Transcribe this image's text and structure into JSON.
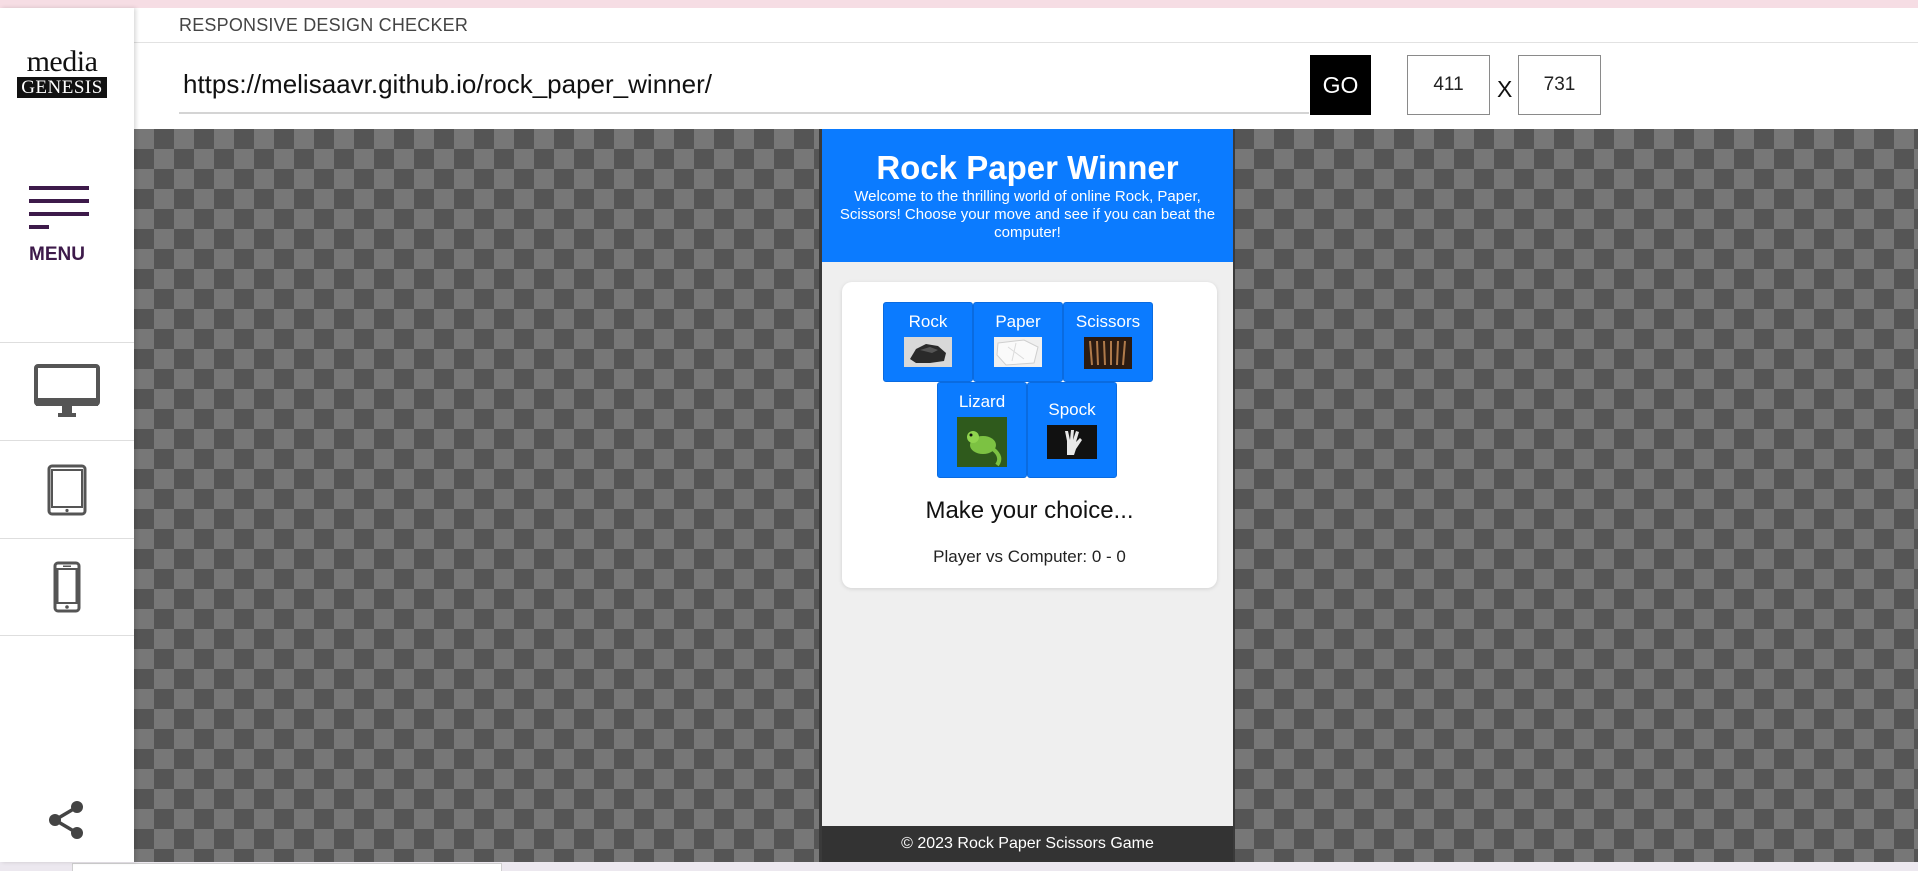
{
  "app": {
    "title": "RESPONSIVE DESIGN CHECKER",
    "logo_top": "media",
    "logo_bottom": "GENESIS",
    "menu_label": "MENU"
  },
  "sidebar": {
    "devices": [
      {
        "name": "desktop",
        "icon": "desktop-icon"
      },
      {
        "name": "tablet",
        "icon": "tablet-icon"
      },
      {
        "name": "phone",
        "icon": "phone-icon"
      }
    ],
    "share_icon": "share-icon"
  },
  "toolbar": {
    "url": "https://melisaavr.github.io/rock_paper_winner/",
    "go_label": "GO",
    "width": "411",
    "x_label": "X",
    "height": "731"
  },
  "preview": {
    "title": "Rock Paper Winner",
    "intro": "Welcome to the thrilling world of online Rock, Paper, Scissors! Choose your move and see if you can beat the computer!",
    "choices": [
      {
        "label": "Rock",
        "image": "rock-image"
      },
      {
        "label": "Paper",
        "image": "paper-image"
      },
      {
        "label": "Scissors",
        "image": "scissors-image"
      },
      {
        "label": "Lizard",
        "image": "lizard-image"
      },
      {
        "label": "Spock",
        "image": "spock-hand-image"
      }
    ],
    "status": "Make your choice...",
    "score": "Player vs Computer: 0 - 0",
    "footer": "© 2023 Rock Paper Scissors Game"
  },
  "colors": {
    "accent": "#0b7bff",
    "menu": "#3d1a4a",
    "footer_bg": "#333333",
    "go_bg": "#000000"
  }
}
